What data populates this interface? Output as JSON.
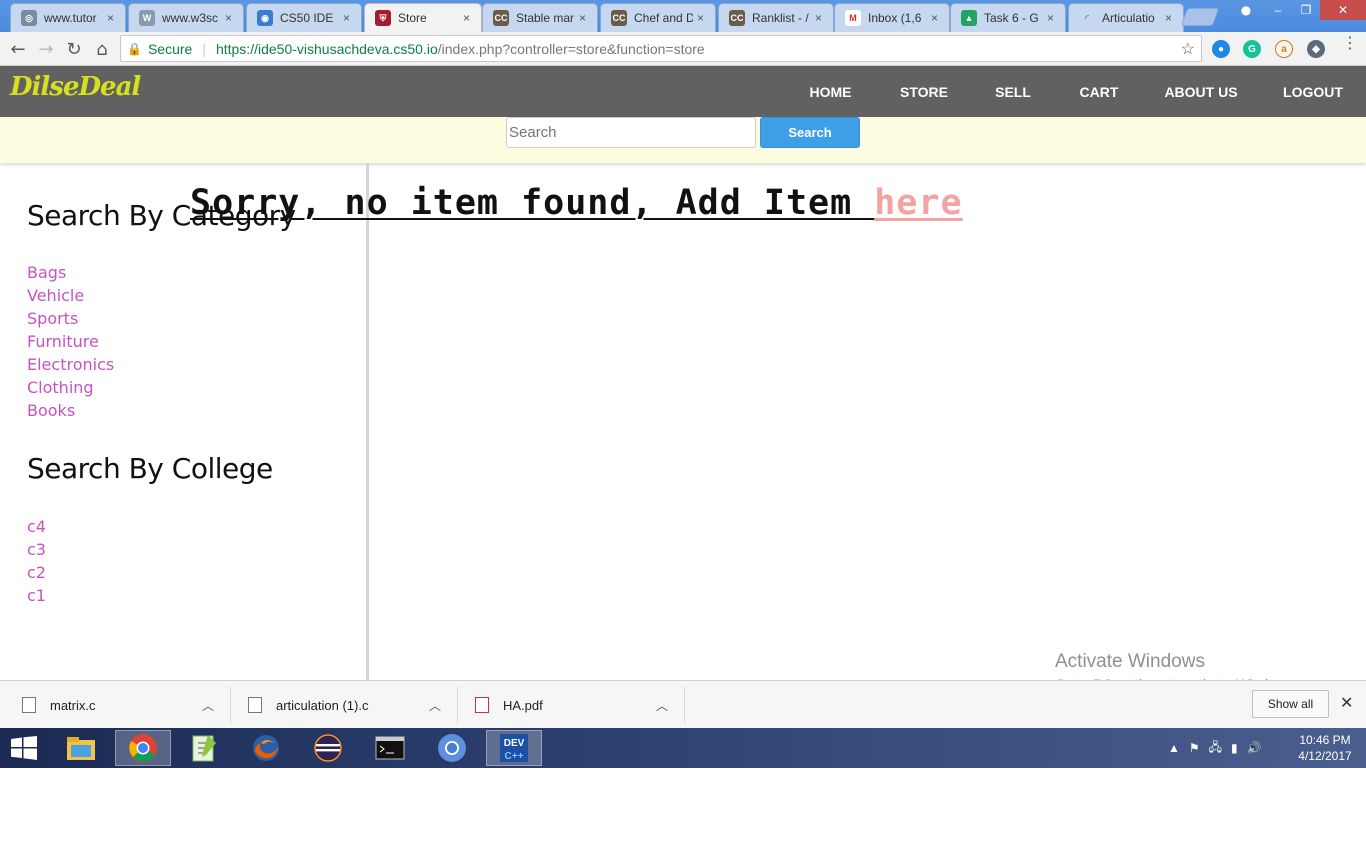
{
  "browser": {
    "tabs": [
      {
        "label": "www.tutor",
        "icon": "tutorials-icon",
        "color": "#7a8aa0"
      },
      {
        "label": "www.w3sc",
        "icon": "w3schools-icon",
        "color": "#8a9bb0"
      },
      {
        "label": "CS50 IDE",
        "icon": "cs50-ide-icon",
        "color": "#3b7bd1"
      },
      {
        "label": "Store",
        "icon": "harvard-shield-icon",
        "color": "#a51c30"
      },
      {
        "label": "Stable mar",
        "icon": "codechef-icon",
        "color": "#6b5b4b"
      },
      {
        "label": "Chef and D",
        "icon": "codechef-icon",
        "color": "#6b5b4b"
      },
      {
        "label": "Ranklist - /",
        "icon": "codechef-icon",
        "color": "#6b5b4b"
      },
      {
        "label": "Inbox (1,6",
        "icon": "gmail-icon",
        "color": "#d93025"
      },
      {
        "label": "Task 6 - G",
        "icon": "google-drive-icon",
        "color": "#1fa463"
      },
      {
        "label": "Articulatio",
        "icon": "loading-icon",
        "color": "#4a89dc"
      }
    ],
    "tab_close_glyph": "×",
    "address": {
      "secure_label": "Secure",
      "url_host": "https://ide50-vishusachdeva.cs50.io",
      "url_path": "/index.php?controller=store&function=store"
    }
  },
  "site": {
    "brand": "DilseDeal",
    "nav": [
      {
        "label": "HOME"
      },
      {
        "label": "STORE"
      },
      {
        "label": "SELL"
      },
      {
        "label": "CART"
      },
      {
        "label": "ABOUT US"
      },
      {
        "label": "LOGOUT"
      }
    ],
    "search": {
      "placeholder": "Search",
      "button_label": "Search"
    },
    "sidebar": {
      "category_heading": "Search By Category",
      "categories": [
        "Bags",
        "Vehicle",
        "Sports",
        "Furniture",
        "Electronics",
        "Clothing",
        "Books"
      ],
      "college_heading": "Search By College",
      "colleges": [
        "c4",
        "c3",
        "c2",
        "c1"
      ]
    },
    "message": {
      "text": "Sorry, no item found, Add Item ",
      "link": "here"
    },
    "colors": {
      "navbar": "#616161",
      "brand": "#d7e01f",
      "search_strip": "#fdfce0",
      "search_button": "#3f9fe6",
      "category_link": "#c652c6",
      "here_link": "#f4a3a3"
    }
  },
  "watermark": {
    "line1": "Activate Windows",
    "line2": "Go to PC settings to activate Windows."
  },
  "downloads": {
    "items": [
      {
        "name": "matrix.c",
        "icon": "c-file-icon"
      },
      {
        "name": "articulation (1).c",
        "icon": "c-file-icon"
      },
      {
        "name": "HA.pdf",
        "icon": "pdf-file-icon"
      }
    ],
    "show_all": "Show all"
  },
  "taskbar": {
    "apps": [
      {
        "name": "file-explorer-icon"
      },
      {
        "name": "chrome-icon",
        "active": true
      },
      {
        "name": "notepad-plus-plus-icon"
      },
      {
        "name": "firefox-icon"
      },
      {
        "name": "eclipse-icon"
      },
      {
        "name": "command-prompt-icon"
      },
      {
        "name": "chromium-icon"
      },
      {
        "name": "dev-cpp-icon",
        "active": true
      }
    ],
    "clock_time": "10:46 PM",
    "clock_date": "4/12/2017"
  }
}
